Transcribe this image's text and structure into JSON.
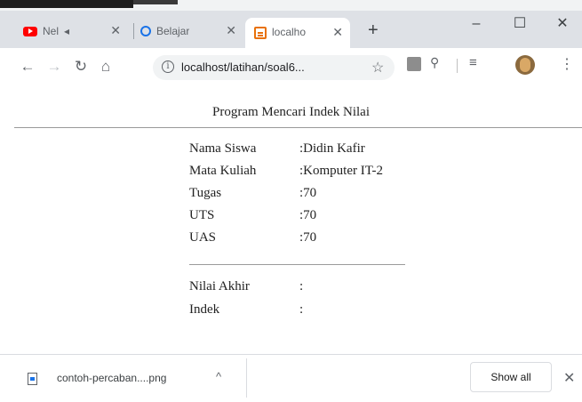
{
  "browser": {
    "tabs": [
      {
        "label": "Nel"
      },
      {
        "label": "Belajar"
      },
      {
        "label": "localho"
      }
    ],
    "new_tab": "+",
    "window_controls": {
      "minimize": "–",
      "maximize": "☐",
      "close": "✕"
    },
    "tab_close": "✕",
    "url": "localhost/latihan/soal6...",
    "icons": {
      "back": "back-arrow-icon",
      "forward": "forward-arrow-icon",
      "reload": "reload-icon",
      "home": "home-icon",
      "info": "info-icon",
      "star": "star-icon"
    }
  },
  "page": {
    "title": "Program Mencari Indek Nilai",
    "fields": [
      {
        "label": "Nama Siswa",
        "value": ":Didin Kafir"
      },
      {
        "label": "Mata Kuliah",
        "value": ":Komputer IT-2"
      },
      {
        "label": "Tugas",
        "value": ":70"
      },
      {
        "label": "UTS",
        "value": ":70"
      },
      {
        "label": "UAS",
        "value": ":70"
      }
    ],
    "results": [
      {
        "label": "Nilai Akhir",
        "value": ":"
      },
      {
        "label": "Indek",
        "value": ":"
      }
    ]
  },
  "download_bar": {
    "file_name": "contoh-percaban....png",
    "caret": "^",
    "show_all": "Show all",
    "close": "✕"
  }
}
